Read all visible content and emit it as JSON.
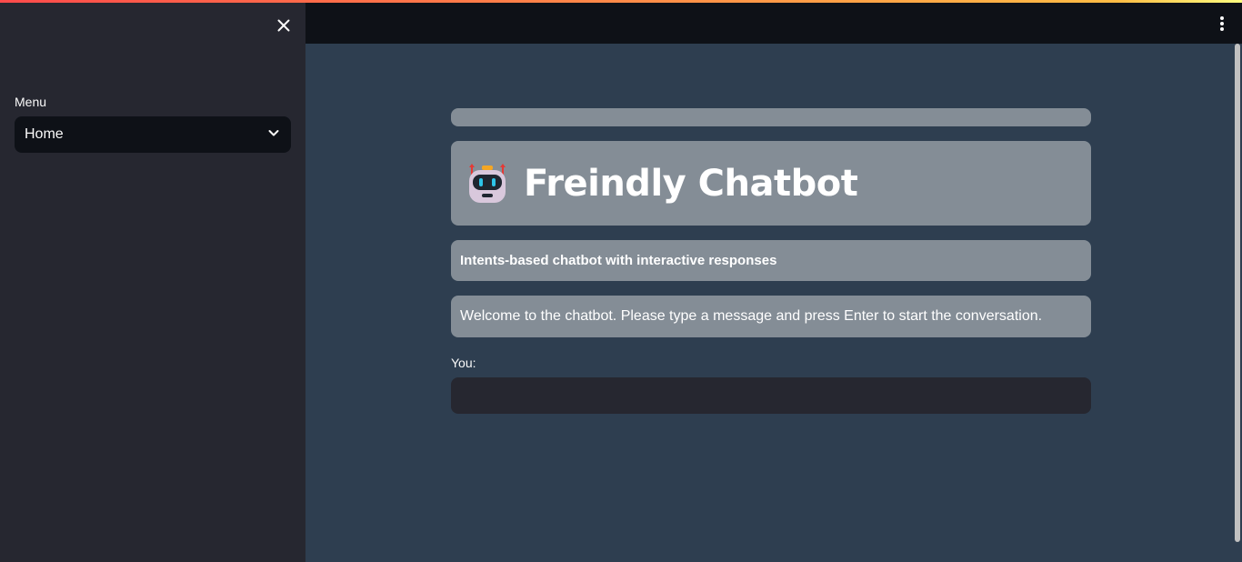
{
  "theme": {
    "sidebar_bg": "#262730",
    "main_bg": "#2e3e50",
    "header_bg": "#0e1117",
    "box_bg": "#848d96",
    "accent_gradient": [
      "#ff4b4b",
      "#ffbd45",
      "#fffd80"
    ]
  },
  "sidebar": {
    "close_icon": "close-icon",
    "menu_label": "Menu",
    "menu_select_value": "Home",
    "menu_select_icon": "chevron-down-icon"
  },
  "header": {
    "menu_icon": "kebab-menu-icon"
  },
  "main": {
    "title_icon": "robot-icon",
    "title": "Freindly Chatbot",
    "subtitle": "Intents-based chatbot with interactive responses",
    "welcome": "Welcome to the chatbot. Please type a message and press Enter to start the conversation.",
    "input_label": "You:",
    "input_value": ""
  }
}
